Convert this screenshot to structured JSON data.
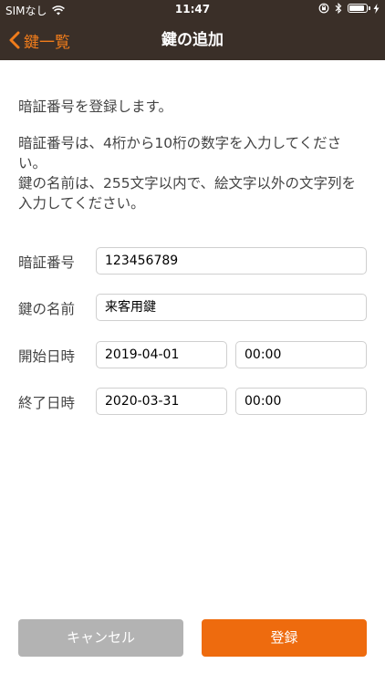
{
  "status_bar": {
    "carrier": "SIMなし",
    "time": "11:47"
  },
  "nav": {
    "back_label": "鍵一覧",
    "title": "鍵の追加"
  },
  "description": {
    "line1": "暗証番号を登録します。",
    "line2": "暗証番号は、4桁から10桁の数字を入力してください。",
    "line3": "鍵の名前は、255文字以内で、絵文字以外の文字列を入力してください。"
  },
  "form": {
    "pin": {
      "label": "暗証番号",
      "value": "123456789"
    },
    "name": {
      "label": "鍵の名前",
      "value": "来客用鍵"
    },
    "start": {
      "label": "開始日時",
      "date": "2019-04-01",
      "time": "00:00"
    },
    "end": {
      "label": "終了日時",
      "date": "2020-03-31",
      "time": "00:00"
    }
  },
  "buttons": {
    "cancel": "キャンセル",
    "register": "登録"
  },
  "colors": {
    "bar_background": "#3a2f28",
    "accent": "#ee6b0e",
    "cancel_button": "#b3b3b3"
  }
}
